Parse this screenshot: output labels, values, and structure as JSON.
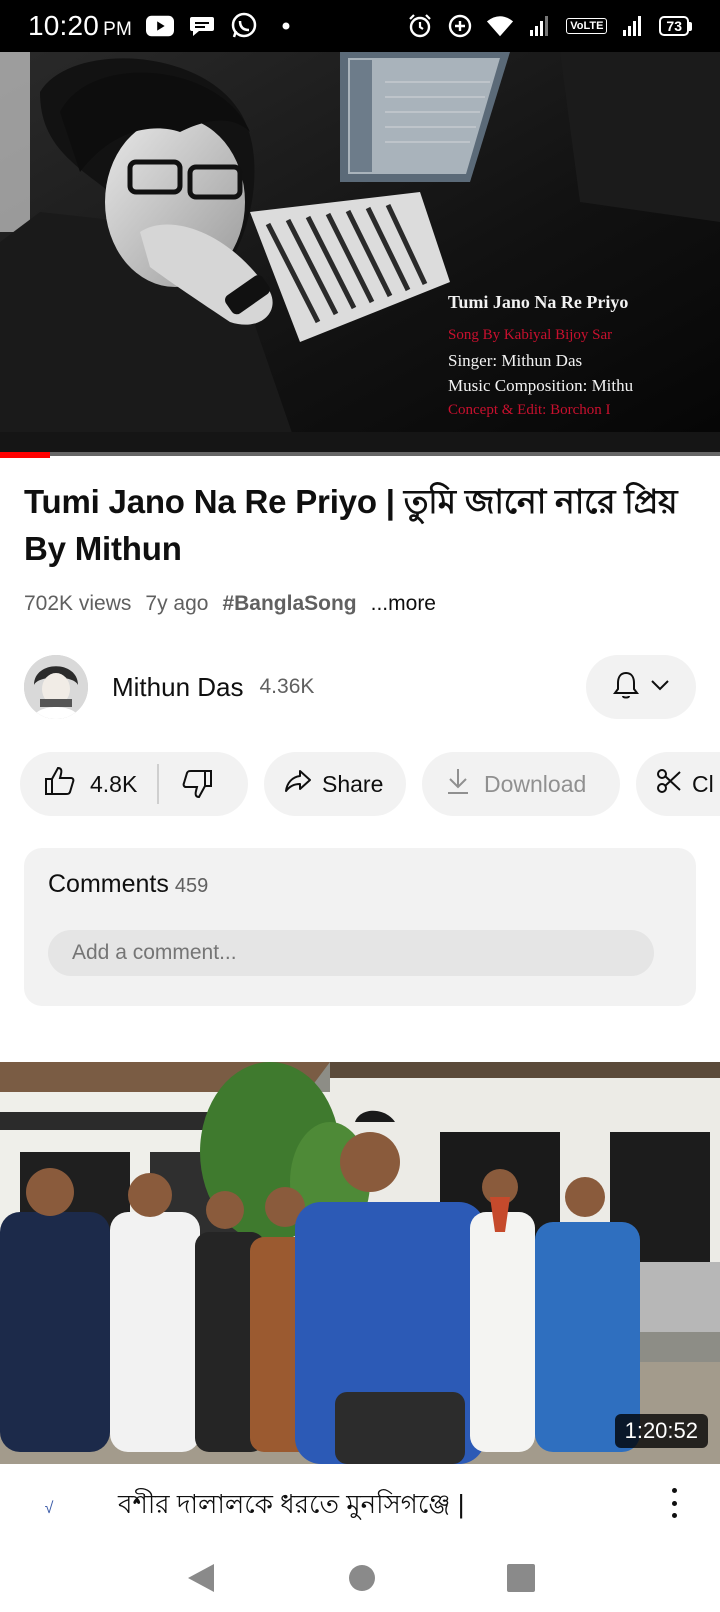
{
  "status_bar": {
    "time": "10:20",
    "ampm": "PM",
    "network_badge": "VoLTE",
    "battery": "73",
    "left_icons": [
      "youtube-icon",
      "chat-bubble-icon",
      "whatsapp-icon",
      "dot-icon"
    ],
    "right_icons": [
      "alarm-icon",
      "data-saver-icon",
      "wifi-icon",
      "signal-icon",
      "signal-icon",
      "battery-icon"
    ]
  },
  "player": {
    "overlay": {
      "title": "Tumi Jano Na Re Priyo",
      "line1": "Song By Kabiyal Bijoy Sar",
      "line2": "Singer: Mithun Das",
      "line3": "Music Composition: Mithu",
      "line4": "Concept & Edit: Borchon I"
    },
    "progress_fraction": 0.07
  },
  "video": {
    "title": "Tumi Jano Na Re Priyo | তুমি জানো নারে প্রিয় By Mithun",
    "views": "702K views",
    "age": "7y ago",
    "hashtag": "#BanglaSong",
    "more": "...more"
  },
  "channel": {
    "name": "Mithun Das",
    "subscribers": "4.36K"
  },
  "actions": {
    "likes": "4.8K",
    "share": "Share",
    "download": "Download",
    "clip": "Cl"
  },
  "comments": {
    "label": "Comments",
    "count": "459",
    "placeholder": "Add a comment..."
  },
  "next_video": {
    "duration": "1:20:52",
    "title": "বশীর দালালকে ধরতে মুনসিগঞ্জে |",
    "avatar_text": "√"
  },
  "colors": {
    "progress": "#ff0000",
    "pill_bg": "#f2f2f2",
    "secondary_text": "#606060",
    "overlay_red": "#c8102e"
  }
}
